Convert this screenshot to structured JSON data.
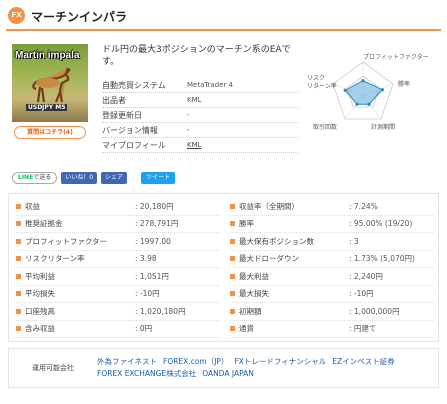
{
  "header": {
    "badge": "FX",
    "title": "マーチンインパラ"
  },
  "ea_image": {
    "title": "Martin impala",
    "subtitle": "USDJPY M5"
  },
  "question_button": "質問はコチラ(4)",
  "description": "ドル円の最大3ポジションのマーチン系のEAです。",
  "info": [
    {
      "label": "自動売買システム",
      "value": "MetaTrader 4"
    },
    {
      "label": "出品者",
      "value": "KML"
    },
    {
      "label": "登録更新日",
      "value": "-"
    },
    {
      "label": "バージョン情報",
      "value": "-"
    },
    {
      "label": "マイプロフィール",
      "value": "KML"
    }
  ],
  "radar": {
    "axes": [
      "プロフィットファクター",
      "勝率",
      "計測期間",
      "取引回数",
      "リスクリターン率"
    ],
    "values": [
      0.45,
      0.6,
      0.3,
      0.3,
      0.55
    ]
  },
  "social": {
    "line": {
      "prefix": "LINE",
      "suffix": "で送る"
    },
    "like": "いいね！0",
    "share": "シェア",
    "tweet": "ツイート"
  },
  "stats_left": [
    {
      "label": "収益",
      "value": ": 20,180円"
    },
    {
      "label": "推奨証拠金",
      "value": ": 278,791円"
    },
    {
      "label": "プロフィットファクター",
      "value": ": 1997.00"
    },
    {
      "label": "リスクリターン率",
      "value": ": 3.98"
    },
    {
      "label": "平均利益",
      "value": ": 1,051円"
    },
    {
      "label": "平均損失",
      "value": ": -10円"
    },
    {
      "label": "口座残高",
      "value": ": 1,020,180円"
    },
    {
      "label": "含み収益",
      "value": ": 0円"
    }
  ],
  "stats_right": [
    {
      "label": "収益率（全期間）",
      "value": ": 7.24%"
    },
    {
      "label": "勝率",
      "value": ": 95.00% (19/20)"
    },
    {
      "label": "最大保有ポジション数",
      "value": ": 3"
    },
    {
      "label": "最大ドローダウン",
      "value": ": 1.73% (5,070円)"
    },
    {
      "label": "最大利益",
      "value": ": 2,240円"
    },
    {
      "label": "最大損失",
      "value": ": -10円"
    },
    {
      "label": "初期額",
      "value": ": 1,000,000円"
    },
    {
      "label": "通貨",
      "value": ": 円建て"
    }
  ],
  "platforms": {
    "label": "運用可能会社",
    "line1": [
      "外為ファイネスト",
      "FOREX.com（JP）",
      "FXトレードフィナンシャル",
      "EZインベスト証券"
    ],
    "line2": [
      "FOREX EXCHANGE株式会社",
      "OANDA JAPAN"
    ]
  },
  "colors": {
    "accent": "#f0924a",
    "radar_fill": "#5aa9d8",
    "link": "#1a5fa8"
  }
}
